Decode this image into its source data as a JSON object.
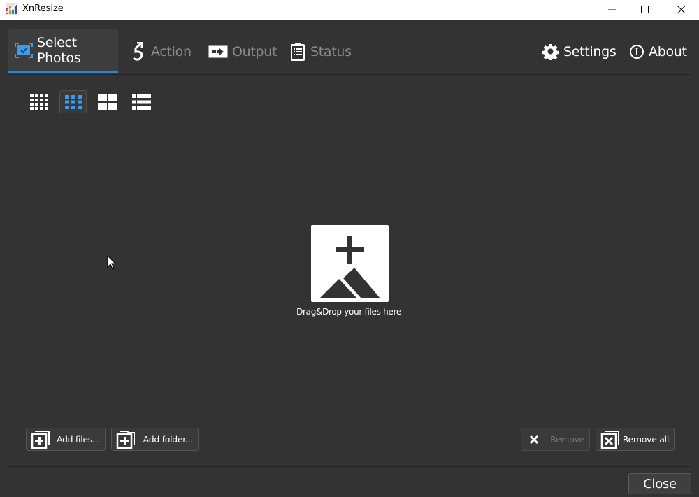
{
  "window": {
    "title": "XnResize",
    "controls": {
      "minimize": "minimize-icon",
      "maximize": "maximize-icon",
      "close": "close-icon"
    }
  },
  "tabs": [
    {
      "label": "Select Photos",
      "icon": "select-photos-icon",
      "active": true
    },
    {
      "label": "Action",
      "icon": "action-icon",
      "active": false
    },
    {
      "label": "Output",
      "icon": "output-icon",
      "active": false
    },
    {
      "label": "Status",
      "icon": "status-icon",
      "active": false
    }
  ],
  "header_right": [
    {
      "label": "Settings",
      "icon": "gear-icon"
    },
    {
      "label": "About",
      "icon": "info-icon"
    }
  ],
  "view_modes": [
    {
      "name": "small-thumbnails",
      "active": false
    },
    {
      "name": "medium-thumbnails",
      "active": true
    },
    {
      "name": "large-thumbnails",
      "active": false
    },
    {
      "name": "details-list",
      "active": false
    }
  ],
  "dropzone": {
    "label": "Drag&Drop your files here"
  },
  "buttons": {
    "add_files": "Add files...",
    "add_folder": "Add folder...",
    "remove": "Remove",
    "remove_all": "Remove all",
    "close": "Close"
  },
  "colors": {
    "accent": "#1e88e5",
    "icon_active": "#3d9be9",
    "background": "#333333",
    "inactive_text": "#8a8a8a"
  }
}
